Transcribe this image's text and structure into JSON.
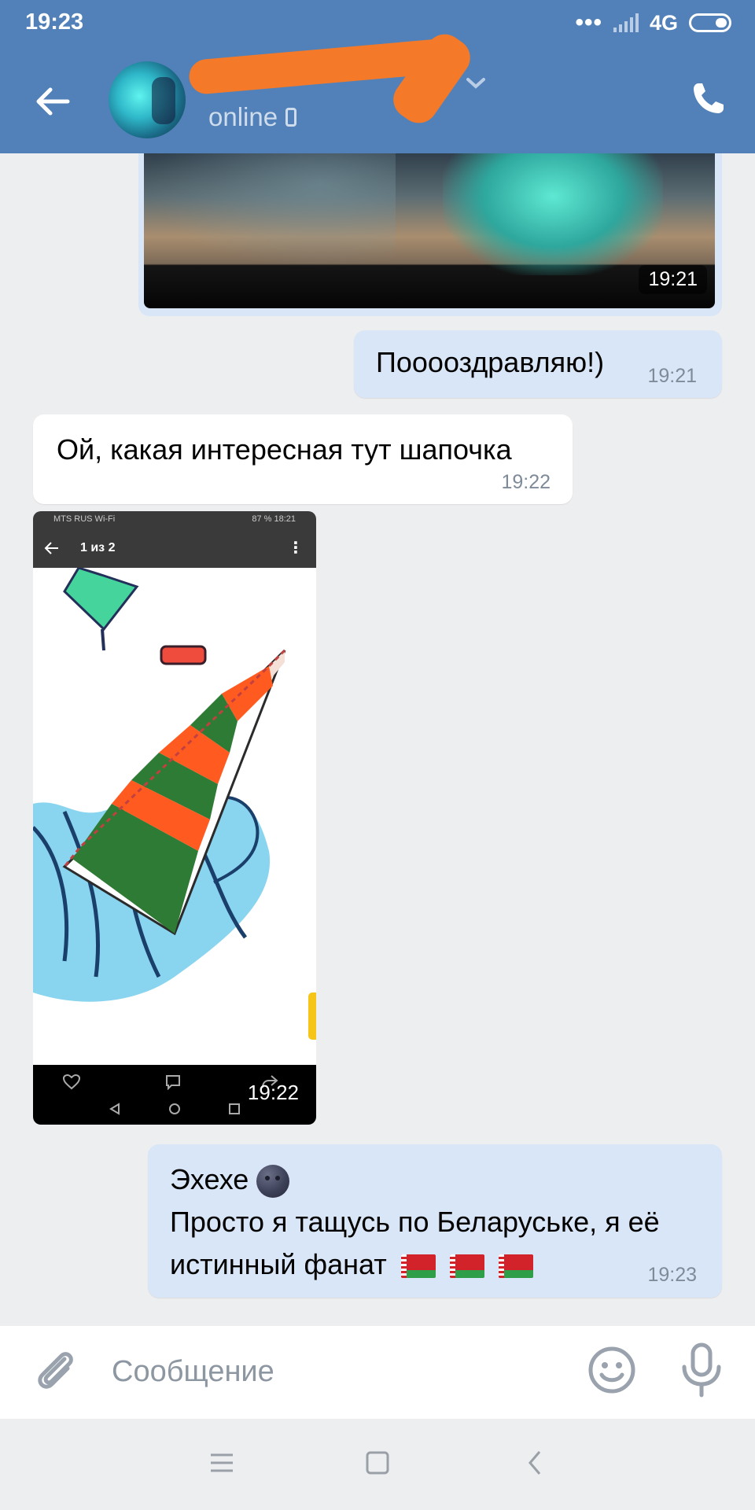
{
  "status_bar": {
    "time": "19:23",
    "network": "4G"
  },
  "header": {
    "presence": "online"
  },
  "messages": [
    {
      "kind": "photo",
      "direction": "in",
      "time": "19:21"
    },
    {
      "kind": "text",
      "direction": "out",
      "text": "Пооооздравляю!)",
      "time": "19:21"
    },
    {
      "kind": "text",
      "direction": "in",
      "text": "Ой, какая интересная тут шапочка",
      "time": "19:22"
    },
    {
      "kind": "photo",
      "direction": "in",
      "time": "19:22",
      "screenshot": {
        "status_left": "MTS RUS Wi-Fi",
        "status_right": "87 %   18:21",
        "counter": "1 из 2"
      }
    },
    {
      "kind": "text",
      "direction": "out",
      "line1": "Эхехе",
      "line2": "Просто я тащусь по Беларуське, я её",
      "line3": "истинный фанат",
      "time": "19:23"
    }
  ],
  "composer": {
    "placeholder": "Сообщение"
  },
  "icons": {
    "back": "arrow-left-icon",
    "call": "phone-icon",
    "attach": "paperclip-icon",
    "emoji": "smile-icon",
    "mic": "microphone-icon"
  },
  "colors": {
    "header": "#5181b8",
    "outgoing_bubble": "#d9e6f7",
    "incoming_bubble": "#ffffff",
    "background": "#edeef0"
  }
}
